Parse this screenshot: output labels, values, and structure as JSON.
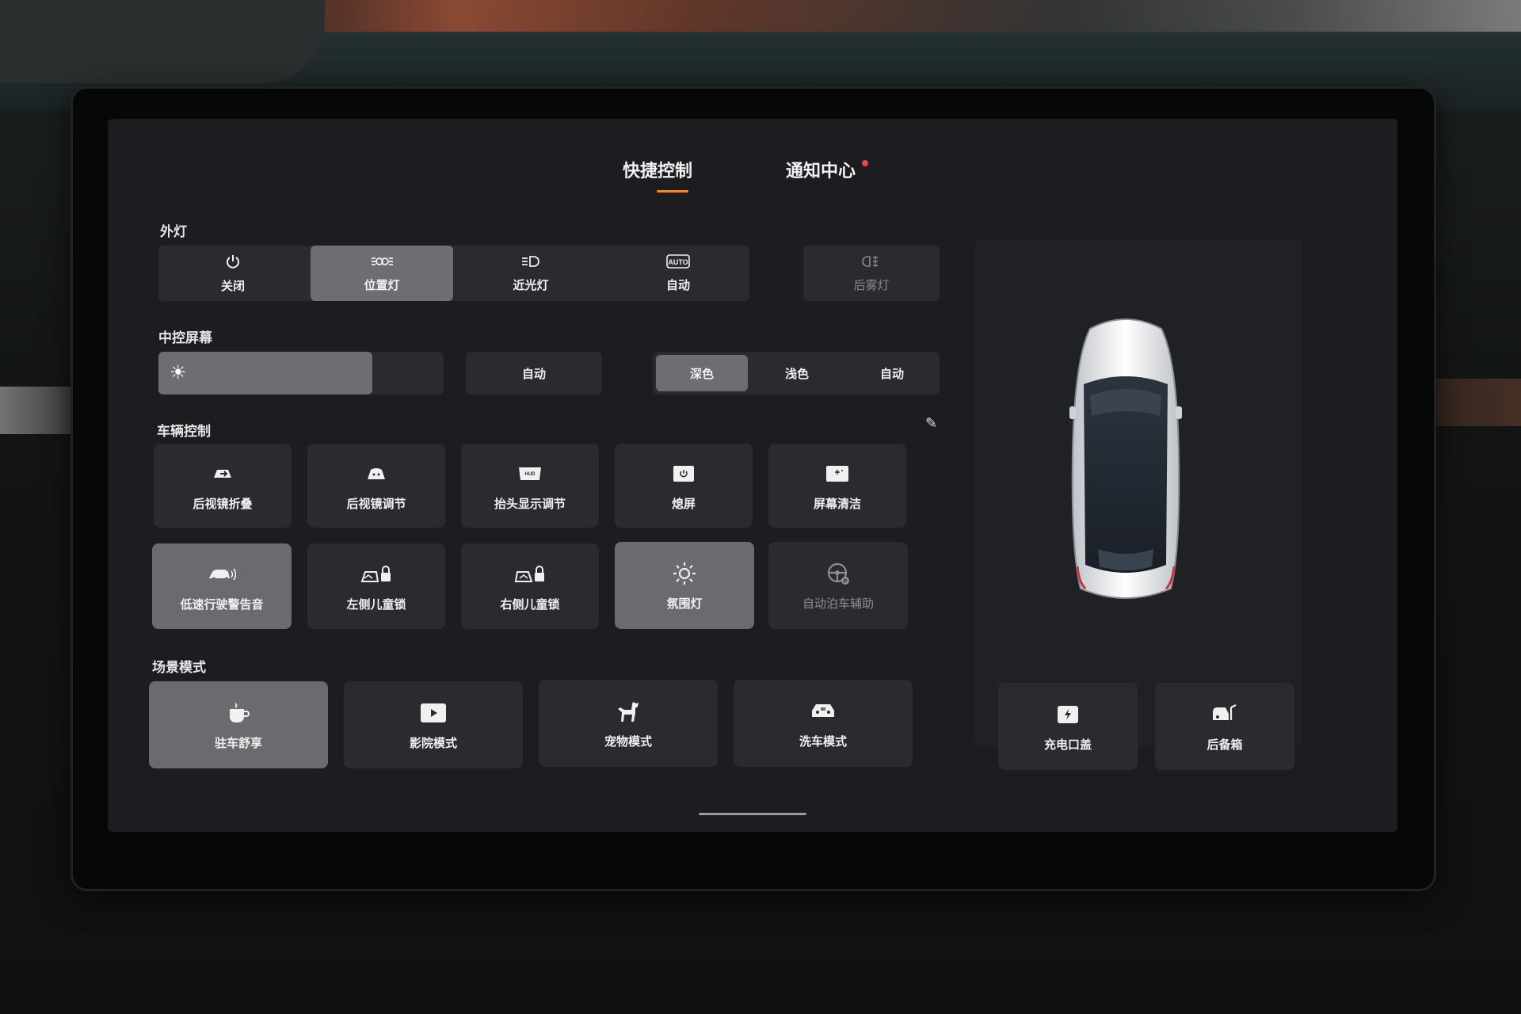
{
  "tabs": [
    {
      "label": "快捷控制",
      "active": true
    },
    {
      "label": "通知中心",
      "has_notification": true
    }
  ],
  "accent_color": "#f08a2b",
  "exterior_lights": {
    "title": "外灯",
    "options": [
      {
        "label": "关闭",
        "icon": "power-icon"
      },
      {
        "label": "位置灯",
        "icon": "position-light-icon",
        "active": true
      },
      {
        "label": "近光灯",
        "icon": "low-beam-icon"
      },
      {
        "label": "自动",
        "icon": "auto-light-icon"
      }
    ],
    "rear_fog": {
      "label": "后雾灯",
      "icon": "rear-fog-icon",
      "disabled": true
    }
  },
  "center_screen": {
    "title": "中控屏幕",
    "brightness_level": 0.75,
    "brightness_auto": "自动",
    "theme_options": [
      {
        "label": "深色",
        "active": true
      },
      {
        "label": "浅色"
      },
      {
        "label": "自动"
      }
    ]
  },
  "vehicle_control": {
    "title": "车辆控制",
    "tiles": [
      {
        "label": "后视镜折叠",
        "icon": "mirror-fold-icon"
      },
      {
        "label": "后视镜调节",
        "icon": "mirror-adjust-icon"
      },
      {
        "label": "抬头显示调节",
        "icon": "hud-icon"
      },
      {
        "label": "熄屏",
        "icon": "screen-off-icon"
      },
      {
        "label": "屏幕清洁",
        "icon": "screen-clean-icon"
      },
      {
        "label": "低速行驶警告音",
        "icon": "low-speed-warning-icon",
        "active": true
      },
      {
        "label": "左侧儿童锁",
        "icon": "left-child-lock-icon"
      },
      {
        "label": "右侧儿童锁",
        "icon": "right-child-lock-icon"
      },
      {
        "label": "氛围灯",
        "icon": "ambient-light-icon",
        "active": true
      },
      {
        "label": "自动泊车辅助",
        "icon": "auto-parking-icon",
        "disabled": true
      }
    ]
  },
  "scene_modes": {
    "title": "场景模式",
    "tiles": [
      {
        "label": "驻车舒享",
        "icon": "coffee-cup-icon",
        "active": true
      },
      {
        "label": "影院模式",
        "icon": "play-icon"
      },
      {
        "label": "宠物模式",
        "icon": "dog-icon"
      },
      {
        "label": "洗车模式",
        "icon": "car-wash-icon"
      }
    ]
  },
  "car_panel": {
    "buttons": [
      {
        "label": "充电口盖",
        "icon": "charge-port-icon"
      },
      {
        "label": "后备箱",
        "icon": "trunk-icon"
      }
    ]
  }
}
